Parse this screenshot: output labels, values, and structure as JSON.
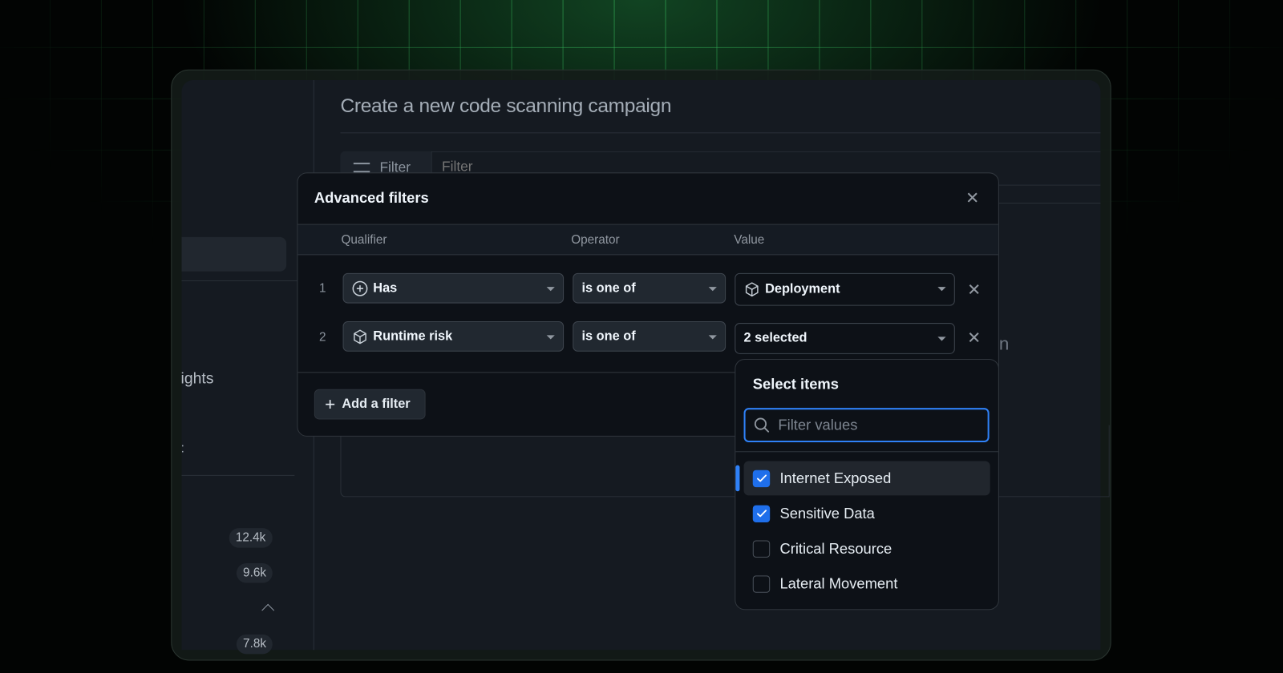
{
  "page": {
    "title": "Create a new code scanning campaign"
  },
  "filter_bar": {
    "button_label": "Filter",
    "placeholder": "Filter"
  },
  "sidebar": {
    "partial_label_1": "ights",
    "partial_label_2": ":",
    "counts": [
      "12.4k",
      "9.6k",
      "7.8k"
    ]
  },
  "background_partial_text": "n",
  "modal": {
    "title": "Advanced filters",
    "columns": {
      "qualifier": "Qualifier",
      "operator": "Operator",
      "value": "Value"
    },
    "rows": [
      {
        "number": "1",
        "qualifier": "Has",
        "qualifier_icon": "plus-circle-icon",
        "operator": "is one of",
        "value": "Deployment",
        "value_icon": "package-icon"
      },
      {
        "number": "2",
        "qualifier": "Runtime risk",
        "qualifier_icon": "package-icon",
        "operator": "is one of",
        "value": "2 selected"
      }
    ],
    "add_filter_label": "Add a filter"
  },
  "select_panel": {
    "title": "Select items",
    "search_placeholder": "Filter values",
    "search_value": "",
    "items": [
      {
        "label": "Internet Exposed",
        "checked": true
      },
      {
        "label": "Sensitive Data",
        "checked": true
      },
      {
        "label": "Critical Resource",
        "checked": false
      },
      {
        "label": "Lateral Movement",
        "checked": false
      }
    ]
  },
  "colors": {
    "accent": "#1f6feb",
    "focus": "#2f81f7",
    "grid": "#3cc864"
  }
}
